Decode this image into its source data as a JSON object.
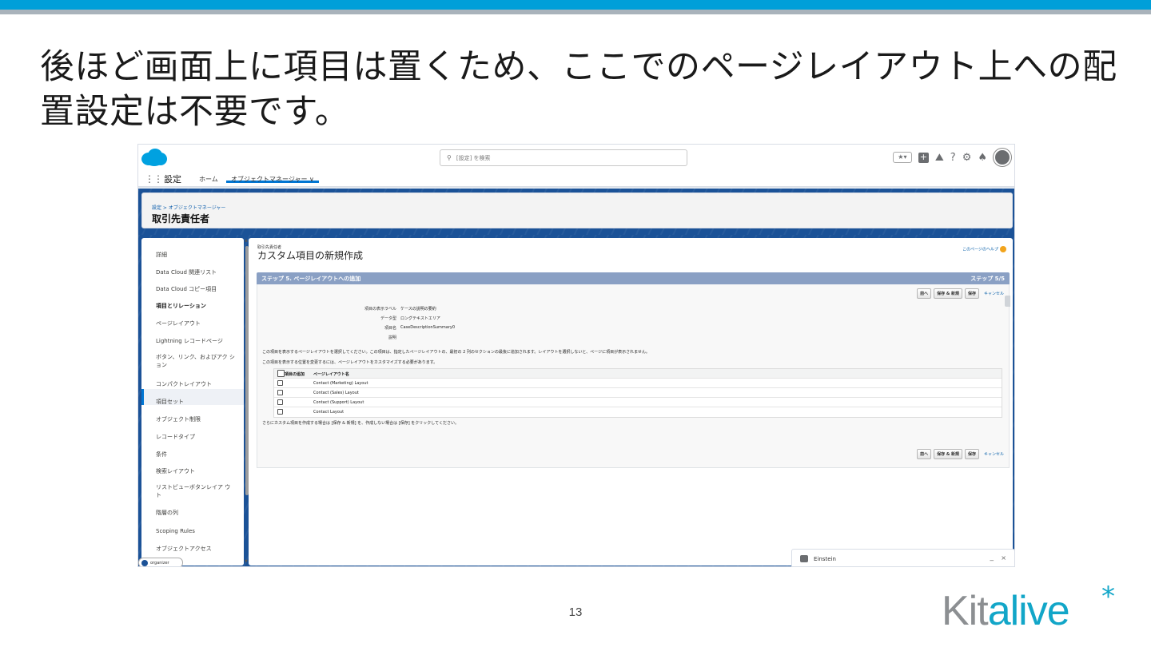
{
  "slide": {
    "heading_line1": "後ほど画面上に項目は置くため、ここでのページレイアウト上への配",
    "heading_line2": "置設定は不要です。",
    "page_number": "13",
    "logo_kit": "Kit",
    "logo_alive": "alive",
    "logo_star": "*",
    "colors": {
      "band": "#009fd9",
      "brand": "#12a6c8"
    }
  },
  "sf": {
    "search_placeholder": "[設定] を検索",
    "app_name": "設定",
    "tab_home": "ホーム",
    "tab_object_manager": "オブジェクトマネージャー ∨",
    "breadcrumb": "設定 > オブジェクトマネージャー",
    "entity_title": "取引先責任者",
    "sidebar": [
      "詳細",
      "Data Cloud 関連リスト",
      "Data Cloud コピー項目",
      "項目とリレーション",
      "ページレイアウト",
      "Lightning レコードページ",
      "ボタン、リンク、およびアク ション",
      "コンパクトレイアウト",
      "項目セット",
      "オブジェクト制限",
      "レコードタイプ",
      "条件",
      "検索レイアウト",
      "リストビューボタンレイア ウト",
      "階層の列",
      "Scoping Rules",
      "オブジェクトアクセス"
    ],
    "main": {
      "object_label": "取引先責任者",
      "page_title": "カスタム項目の新規作成",
      "help_link": "このページのヘルプ",
      "step_title": "ステップ 5. ページレイアウトへの追加",
      "step_number": "ステップ 5/5",
      "btn_prev": "前へ",
      "btn_save_new": "保存 & 新規",
      "btn_save": "保存",
      "btn_cancel": "キャンセル",
      "fields": [
        {
          "label": "項目の表示ラベル",
          "value": "ケースの説明の要約"
        },
        {
          "label": "データ型",
          "value": "ロングテキストエリア"
        },
        {
          "label": "項目名",
          "value": "CaseDescriptionSummary0"
        },
        {
          "label": "説明",
          "value": ""
        }
      ],
      "note1": "この項目を表示するページレイアウトを選択してください。この項目は、指定したページレイアウトの、最初の 2 列のセクションの最後に追加されます。レイアウトを選択しないと、ページに項目が表示されません。",
      "note2": "この項目を表示する位置を変更するには、ページレイアウトをカスタマイズする必要があります。",
      "table_col_add": "項目の追加",
      "table_col_layout": "ページレイアウト名",
      "layouts": [
        "Contact (Marketing) Layout",
        "Contact (Sales) Layout",
        "Contact (Support) Layout",
        "Contact Layout"
      ],
      "note3": "さらにカスタム項目を作成する場合は [保存 & 新規] を、作成しない場合は [保存] をクリックしてください。"
    },
    "organizer": "organizer",
    "einstein_label": "Einstein",
    "einstein_min": "_",
    "einstein_close": "×"
  }
}
